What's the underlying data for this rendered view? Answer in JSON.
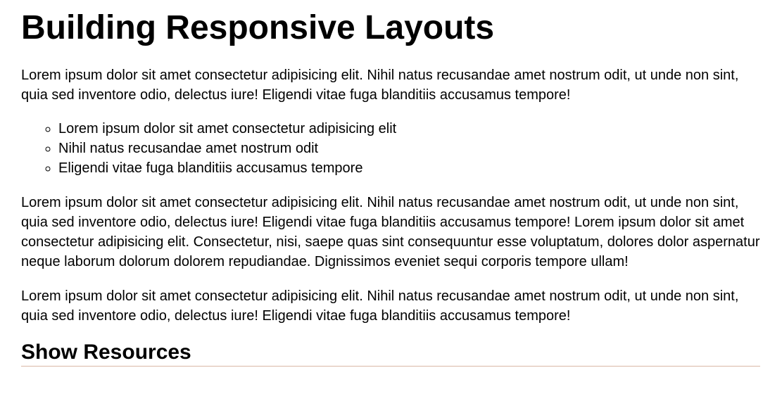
{
  "page": {
    "title": "Building Responsive Layouts"
  },
  "paragraphs": [
    "Lorem ipsum dolor sit amet consectetur adipisicing elit. Nihil natus recusandae amet nostrum odit, ut unde non sint, quia sed inventore odio, delectus iure! Eligendi vitae fuga blanditiis accusamus tempore!",
    "Lorem ipsum dolor sit amet consectetur adipisicing elit. Nihil natus recusandae amet nostrum odit, ut unde non sint, quia sed inventore odio, delectus iure! Eligendi vitae fuga blanditiis accusamus tempore! Lorem ipsum dolor sit amet consectetur adipisicing elit. Consectetur, nisi, saepe quas sint consequuntur esse voluptatum, dolores dolor aspernatur neque laborum dolorum dolorem repudiandae. Dignissimos eveniet sequi corporis tempore ullam!",
    "Lorem ipsum dolor sit amet consectetur adipisicing elit. Nihil natus recusandae amet nostrum odit, ut unde non sint, quia sed inventore odio, delectus iure! Eligendi vitae fuga blanditiis accusamus tempore!"
  ],
  "list_items": [
    "Lorem ipsum dolor sit amet consectetur adipisicing elit",
    "Nihil natus recusandae amet nostrum odit",
    "Eligendi vitae fuga blanditiis accusamus tempore"
  ],
  "resources": {
    "toggle_label": "Show Resources"
  },
  "colors": {
    "divider": "#d9b8a6",
    "text": "#000000",
    "background": "#ffffff"
  }
}
